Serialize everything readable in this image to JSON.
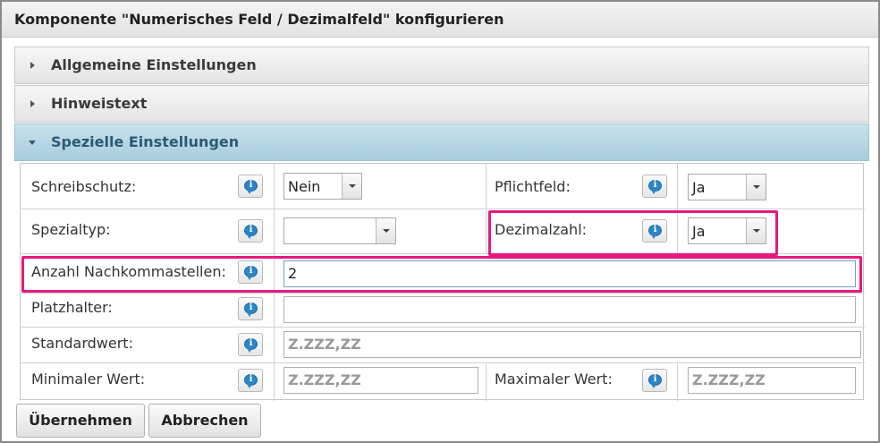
{
  "dialog": {
    "title": "Komponente \"Numerisches Feld / Dezimalfeld\" konfigurieren"
  },
  "accordion": {
    "general": "Allgemeine Einstellungen",
    "hint": "Hinweistext",
    "special": "Spezielle Einstellungen"
  },
  "form": {
    "readonly": {
      "label": "Schreibschutz:",
      "value": "Nein"
    },
    "required": {
      "label": "Pflichtfeld:",
      "value": "Ja"
    },
    "special_type": {
      "label": "Spezialtyp:",
      "value": ""
    },
    "decimal": {
      "label": "Dezimalzahl:",
      "value": "Ja"
    },
    "decimal_places": {
      "label": "Anzahl Nachkommastellen:",
      "value": "2"
    },
    "placeholder_field": {
      "label": "Platzhalter:",
      "value": ""
    },
    "default_value": {
      "label": "Standardwert:",
      "placeholder": "Z.ZZZ,ZZ"
    },
    "min_value": {
      "label": "Minimaler Wert:",
      "placeholder": "Z.ZZZ,ZZ"
    },
    "max_value": {
      "label": "Maximaler Wert:",
      "placeholder": "Z.ZZZ,ZZ"
    }
  },
  "info_icon_glyph": "i",
  "buttons": {
    "apply": "Übernehmen",
    "cancel": "Abbrechen"
  },
  "colors": {
    "highlight": "#e6197e",
    "accent_header": "#a7cddd",
    "info_icon": "#2b85c6"
  }
}
